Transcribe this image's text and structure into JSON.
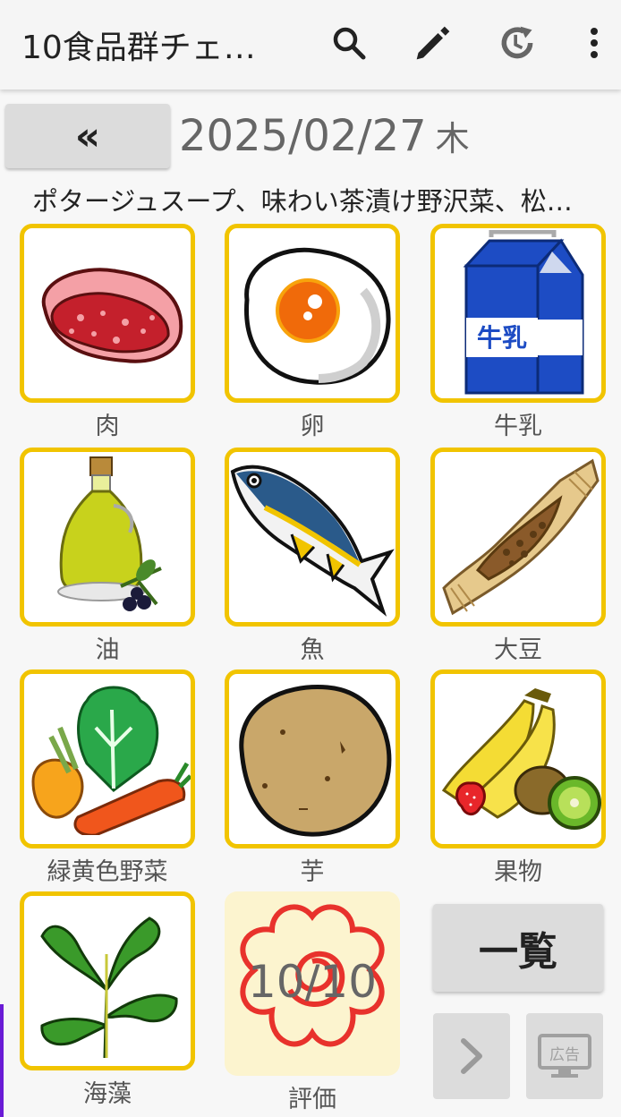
{
  "appbar": {
    "title": "10食品群チェ…",
    "icons": [
      "search-icon",
      "pencil-icon",
      "history-icon",
      "more-vert-icon"
    ]
  },
  "date_nav": {
    "back_label": "«",
    "date": "2025/02/27",
    "weekday": "木"
  },
  "menu_text": "ポタージュスープ、味わい茶漬け野沢菜、松…",
  "food_groups": [
    {
      "label": "肉",
      "icon": "meat-icon"
    },
    {
      "label": "卵",
      "icon": "fried-egg-icon"
    },
    {
      "label": "牛乳",
      "icon": "milk-carton-icon",
      "icon_text": "牛乳"
    },
    {
      "label": "油",
      "icon": "olive-oil-icon"
    },
    {
      "label": "魚",
      "icon": "fish-icon"
    },
    {
      "label": "大豆",
      "icon": "natto-icon"
    },
    {
      "label": "緑黄色野菜",
      "icon": "vegetables-icon"
    },
    {
      "label": "芋",
      "icon": "potato-icon"
    },
    {
      "label": "果物",
      "icon": "fruit-icon"
    },
    {
      "label": "海藻",
      "icon": "seaweed-icon"
    }
  ],
  "score": {
    "value": "10/10",
    "label": "評価",
    "icon": "flower-stamp-icon"
  },
  "list_button": "一覧",
  "ad_button": {
    "label": "広告"
  },
  "colors": {
    "tile_border": "#f1c400",
    "score_bg": "#fcf4cf",
    "stamp_red": "#e8322c"
  }
}
